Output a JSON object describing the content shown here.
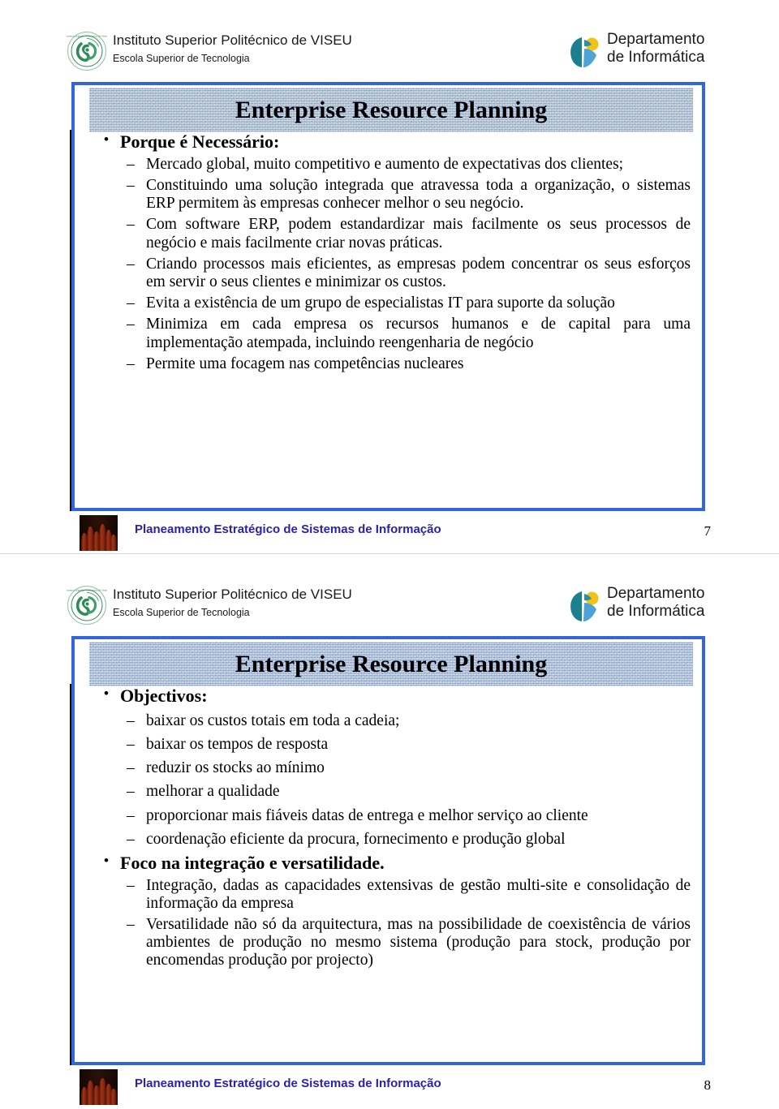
{
  "institution": {
    "name": "Instituto Superior Politécnico de VISEU",
    "school": "Escola Superior de Tecnologia",
    "logo_icon": "viseu-seal-icon"
  },
  "department": {
    "line1": "Departamento",
    "line2": "de Informática",
    "logo_icon": "departamento-informatica-logo-icon"
  },
  "colors": {
    "frame_blue": "#3366dd",
    "title_band": "#a8bcdc",
    "footer_text": "#2b22a8",
    "dept_teal": "#1b7f8e",
    "dept_yellow": "#f2c314",
    "dept_lightblue": "#4ea3d6"
  },
  "footer": {
    "text": "Planeamento Estratégico de Sistemas de Informação",
    "image_icon": "chess-pieces-photo-icon"
  },
  "slides": [
    {
      "number": "7",
      "title": "Enterprise Resource Planning",
      "bullets": [
        {
          "level": 1,
          "text": "Porque é Necessário:"
        },
        {
          "level": 2,
          "text": "Mercado global, muito competitivo e aumento de expectativas dos clientes;"
        },
        {
          "level": 2,
          "text": "Constituindo uma solução integrada que atravessa toda a organização, o sistemas ERP permitem às empresas conhecer melhor o seu negócio."
        },
        {
          "level": 2,
          "text": "Com software ERP, podem estandardizar mais facilmente os seus processos de negócio e mais facilmente criar novas práticas."
        },
        {
          "level": 2,
          "text": "Criando processos mais eficientes, as empresas podem concentrar os seus esforços em servir o seus clientes e minimizar os custos."
        },
        {
          "level": 2,
          "text": "Evita a existência de um grupo de especialistas IT para suporte da solução"
        },
        {
          "level": 2,
          "text": "Minimiza em cada empresa os recursos humanos e de capital para uma implementação atempada, incluindo reengenharia de negócio"
        },
        {
          "level": 2,
          "text": "Permite uma focagem nas competências nucleares"
        }
      ]
    },
    {
      "number": "8",
      "title": "Enterprise Resource Planning",
      "bullets": [
        {
          "level": 1,
          "text": "Objectivos:"
        },
        {
          "level": 2,
          "text": "baixar os custos totais em toda a cadeia;"
        },
        {
          "level": 2,
          "text": "baixar os tempos de resposta"
        },
        {
          "level": 2,
          "text": "reduzir os stocks ao mínimo"
        },
        {
          "level": 2,
          "text": "melhorar a qualidade"
        },
        {
          "level": 2,
          "text": "proporcionar mais fiáveis datas de entrega e melhor serviço ao cliente"
        },
        {
          "level": 2,
          "text": "coordenação eficiente da procura, fornecimento e produção global"
        },
        {
          "level": 1,
          "text": "Foco na integração e versatilidade."
        },
        {
          "level": 2,
          "text": "Integração, dadas as capacidades extensivas de gestão multi-site e consolidação de informação da empresa"
        },
        {
          "level": 2,
          "text": "Versatilidade não só da arquitectura, mas na possibilidade de coexistência de vários ambientes de produção no mesmo sistema (produção para stock, produção por encomendas produção por projecto)"
        }
      ]
    }
  ]
}
